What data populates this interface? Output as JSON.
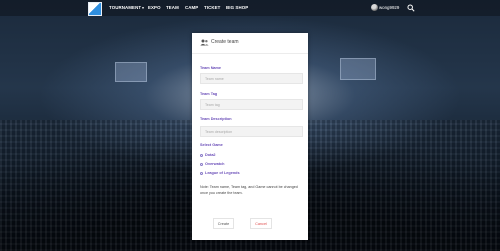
{
  "navbar": {
    "items": [
      {
        "label": "TOURNAMENT",
        "has_dropdown": true
      },
      {
        "label": "EXPO"
      },
      {
        "label": "TEAM"
      },
      {
        "label": "CAMP"
      },
      {
        "label": "TICKET"
      },
      {
        "label": "BIG SHOP"
      }
    ],
    "caret": "▾",
    "username": "wong9929"
  },
  "modal": {
    "title": "Create team",
    "fields": {
      "team_name": {
        "label": "Team Name",
        "placeholder": "Team name"
      },
      "team_tag": {
        "label": "Team Tag",
        "placeholder": "Team tag"
      },
      "team_description": {
        "label": "Team Description",
        "placeholder": "Team description"
      }
    },
    "select_game": {
      "label": "Select Game",
      "options": [
        "Dota2",
        "Overwatch",
        "League of Legends"
      ]
    },
    "note": "Note: Team name, Team tag, and Game cannot be changed once you create the team.",
    "buttons": {
      "create": "Create",
      "cancel": "Cancel"
    }
  },
  "colors": {
    "accent": "#6a4db8",
    "cancel": "#e05050"
  }
}
